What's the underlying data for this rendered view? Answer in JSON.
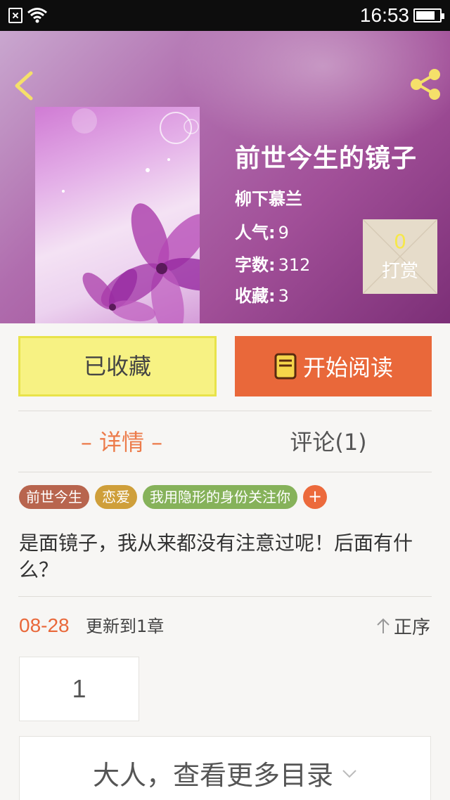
{
  "status_bar": {
    "time": "16:53",
    "battery_level": 0.8
  },
  "book": {
    "title": "前世今生的镜子",
    "author": "柳下慕兰",
    "stats": [
      {
        "label": "人气:",
        "value": "9"
      },
      {
        "label": "字数:",
        "value": "312"
      },
      {
        "label": "收藏:",
        "value": "3"
      }
    ]
  },
  "reward": {
    "count": "0",
    "label": "打赏"
  },
  "actions": {
    "favorite_label": "已收藏",
    "read_label": "开始阅读"
  },
  "tabs": [
    {
      "label": "– 详情 –",
      "active": true
    },
    {
      "label": "评论(1)",
      "active": false
    }
  ],
  "tags": [
    {
      "label": "前世今生",
      "color": "#b8654e"
    },
    {
      "label": "恋爱",
      "color": "#cf9f3a"
    },
    {
      "label": "我用隐形的身份关注你",
      "color": "#86b25a"
    }
  ],
  "tag_add_label": "+",
  "summary": "是面镜子，我从来都没有注意过呢！后面有什么？",
  "update": {
    "date": "08-28",
    "text": "更新到1章",
    "sort_label": "正序"
  },
  "chapters": [
    "1"
  ],
  "more_catalog_label": "大人，查看更多目录",
  "colors": {
    "accent": "#e9683a",
    "favorite_bg": "#f7f283"
  }
}
